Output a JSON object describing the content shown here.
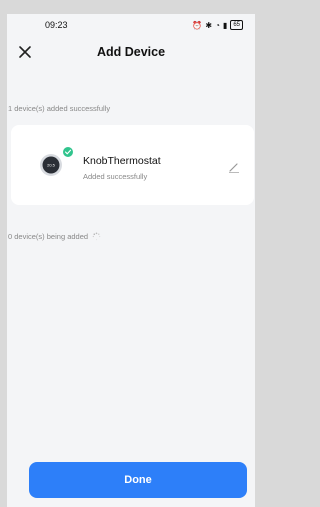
{
  "status_bar": {
    "time": "09:23",
    "battery": "65"
  },
  "header": {
    "title": "Add Device"
  },
  "sections": {
    "added_label": "1 device(s) added successfully",
    "adding_label": "0 device(s) being added"
  },
  "device": {
    "name": "KnobThermostat",
    "status": "Added successfully",
    "display_reading": "20.5"
  },
  "actions": {
    "done_label": "Done"
  },
  "icons": {
    "close": "close-icon",
    "check": "check-icon",
    "edit": "pencil-icon",
    "spinner": "spinner-icon"
  },
  "colors": {
    "accent": "#2d7ff9",
    "success": "#31c48d"
  }
}
